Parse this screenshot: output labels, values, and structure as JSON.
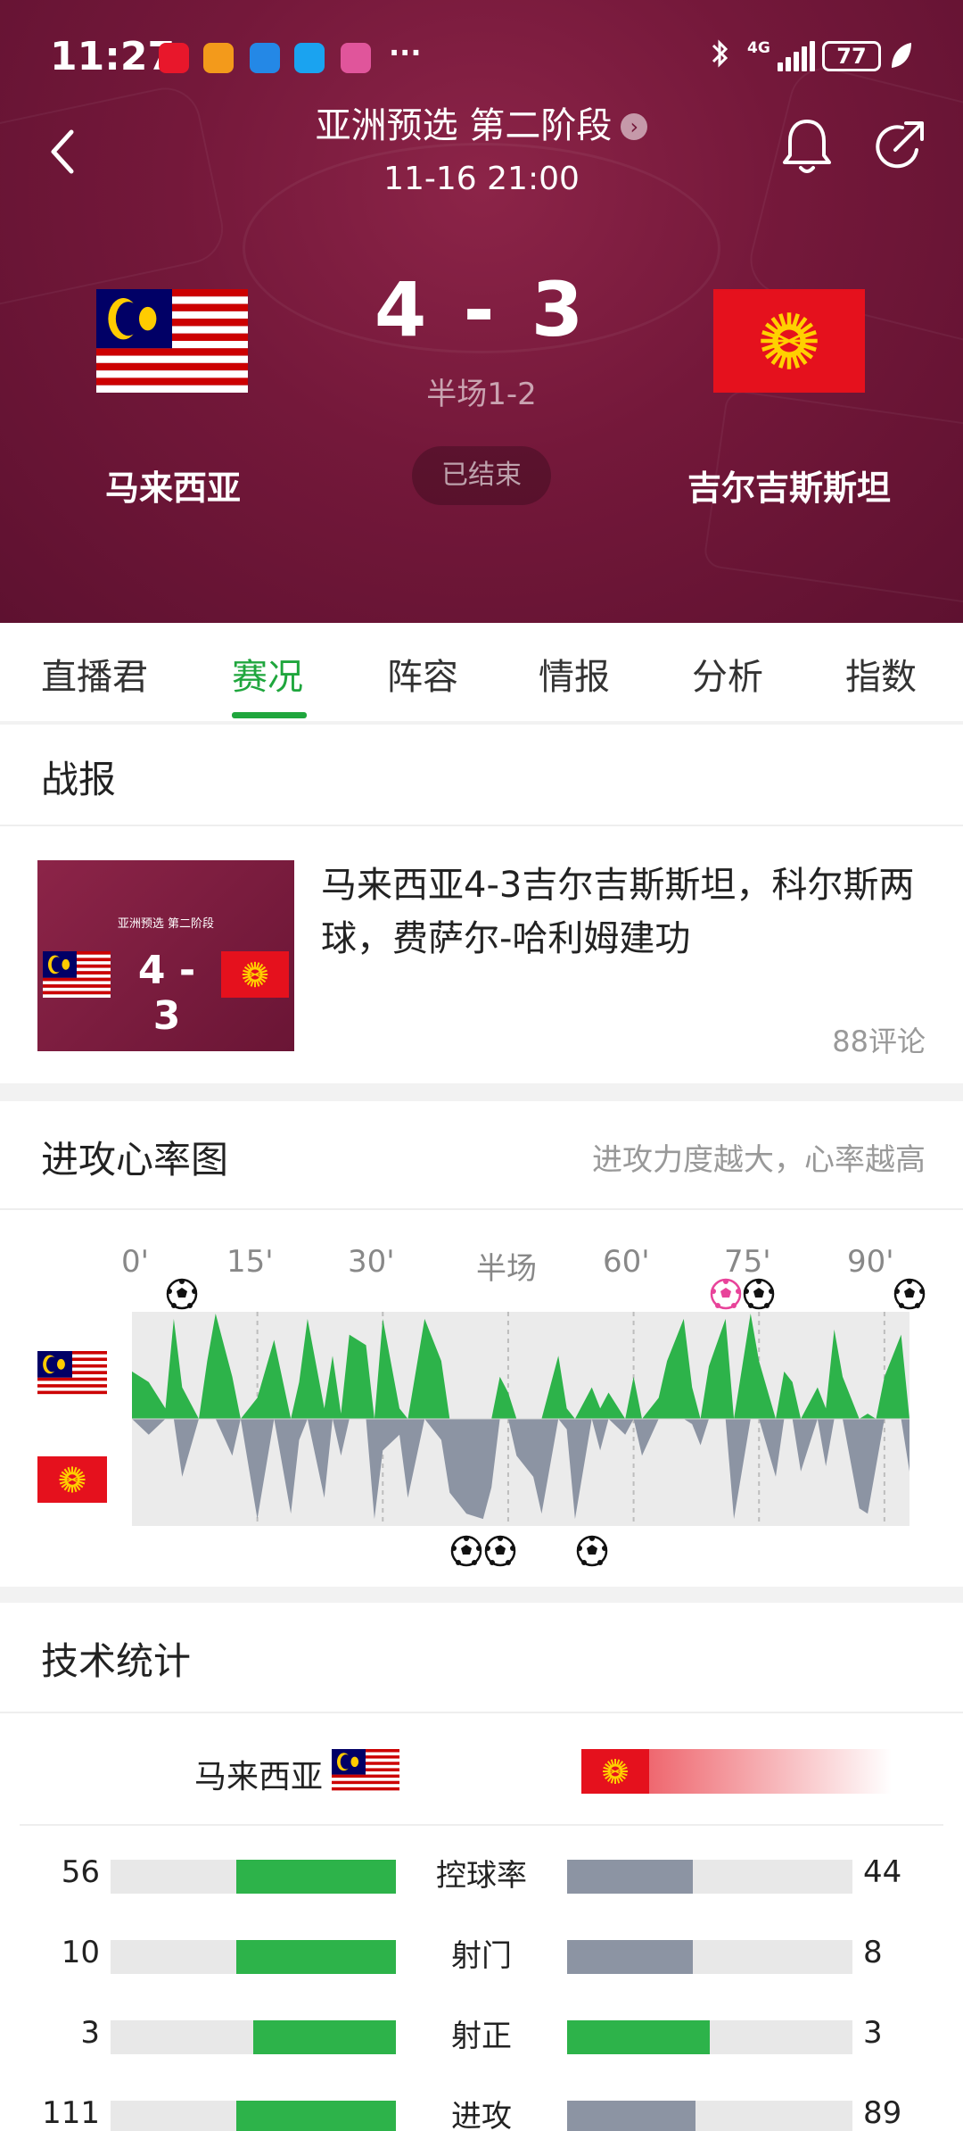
{
  "status_bar": {
    "time": "11:27",
    "network": "4G",
    "battery": "77",
    "notification_icons": [
      {
        "name": "app-icon-red",
        "color": "#e8172b"
      },
      {
        "name": "app-icon-orange",
        "color": "#f39a1b"
      },
      {
        "name": "app-icon-blue",
        "color": "#2488e6"
      },
      {
        "name": "app-icon-search",
        "color": "#1aa3f0"
      },
      {
        "name": "app-icon-pink",
        "color": "#e0559b"
      }
    ],
    "more": "···"
  },
  "header": {
    "title": "亚洲预选 第二阶段",
    "datetime": "11-16 21:00"
  },
  "match": {
    "home_team": "马来西亚",
    "away_team": "吉尔吉斯斯坦",
    "home_score": "4",
    "away_score": "3",
    "separator": "-",
    "halftime": "半场1-2",
    "status": "已结束"
  },
  "tabs": [
    {
      "label": "直播君",
      "active": false
    },
    {
      "label": "赛况",
      "active": true
    },
    {
      "label": "阵容",
      "active": false
    },
    {
      "label": "情报",
      "active": false
    },
    {
      "label": "分析",
      "active": false
    },
    {
      "label": "指数",
      "active": false
    }
  ],
  "report": {
    "section_title": "战报",
    "thumb_title": "亚洲预选 第二阶段",
    "thumb_score": "4 - 3",
    "headline": "马来西亚4-3吉尔吉斯斯坦，科尔斯两球，费萨尔-哈利姆建功",
    "comments": "88评论"
  },
  "heart_chart": {
    "section_title": "进攻心率图",
    "subtitle": "进攻力度越大，心率越高",
    "time_labels": [
      "0'",
      "15'",
      "30'",
      "半场",
      "60'",
      "75'",
      "90'"
    ],
    "colors": {
      "home": "#2db34a",
      "away": "#8c94a3"
    }
  },
  "chart_data": {
    "type": "area",
    "x": [
      0,
      2,
      4,
      5,
      6,
      8,
      9,
      10,
      12,
      13,
      15,
      17,
      19,
      20,
      21,
      23,
      24,
      25,
      26,
      28,
      29,
      30,
      32,
      33,
      35,
      37,
      38,
      40,
      42,
      43,
      44,
      45,
      46,
      48,
      49,
      51,
      52,
      53,
      55,
      56,
      57,
      59,
      60,
      61,
      63,
      64,
      66,
      67,
      68,
      69,
      71,
      72,
      74,
      75,
      77,
      78,
      79,
      80,
      82,
      83,
      84,
      85,
      87,
      88,
      89,
      90,
      92,
      93
    ],
    "series": [
      {
        "values": [
          0.45,
          0.35,
          0.1,
          0.95,
          0.3,
          0.0,
          0.55,
          1.0,
          0.4,
          0.0,
          0.2,
          0.75,
          0.0,
          0.35,
          0.95,
          0.1,
          0.6,
          0.05,
          0.8,
          0.7,
          0.0,
          0.95,
          0.1,
          0.0,
          0.95,
          0.55,
          0.0,
          0.0,
          0.0,
          0.0,
          0.4,
          0.25,
          0.0,
          0.0,
          0.0,
          0.6,
          0.1,
          0.0,
          0.3,
          0.1,
          0.25,
          0.0,
          0.4,
          0.0,
          0.2,
          0.55,
          0.95,
          0.3,
          0.0,
          0.5,
          0.95,
          0.0,
          1.0,
          0.55,
          0.0,
          0.45,
          0.35,
          0.0,
          0.3,
          0.1,
          0.85,
          0.4,
          0.0,
          0.05,
          0.0,
          0.4,
          0.8,
          0.0
        ]
      },
      {
        "values": [
          0.0,
          0.15,
          0.0,
          0.0,
          0.55,
          0.0,
          0.0,
          0.0,
          0.35,
          0.0,
          0.95,
          0.0,
          0.9,
          0.2,
          0.0,
          0.75,
          0.0,
          0.35,
          0.0,
          0.0,
          0.95,
          0.3,
          0.15,
          0.75,
          0.0,
          0.2,
          0.7,
          0.9,
          0.95,
          0.65,
          0.0,
          0.0,
          0.35,
          0.55,
          0.9,
          0.0,
          0.1,
          0.95,
          0.0,
          0.3,
          0.0,
          0.15,
          0.0,
          0.35,
          0.0,
          0.0,
          0.0,
          0.05,
          0.25,
          0.0,
          0.0,
          0.95,
          0.0,
          0.0,
          0.55,
          0.0,
          0.0,
          0.5,
          0.0,
          0.45,
          0.0,
          0.0,
          0.85,
          0.9,
          0.45,
          0.0,
          0.0,
          0.5
        ]
      }
    ],
    "home_goals_minutes": [
      6,
      71,
      75,
      93
    ],
    "home_goal_types": [
      "normal",
      "penalty",
      "normal",
      "normal"
    ],
    "away_goals_minutes": [
      40,
      44,
      55
    ],
    "xlim": [
      0,
      93
    ],
    "ylim": [
      -1,
      1
    ],
    "grid": "vertical dashed at 15' intervals",
    "legend": "flags on left"
  },
  "stats": {
    "section_title": "技术统计",
    "home_name": "马来西亚",
    "rows": [
      {
        "label": "控球率",
        "home": "56",
        "away": "44",
        "home_frac": 0.56,
        "away_frac": 0.44,
        "home_color": "#2db34a",
        "away_color": "#8c94a3"
      },
      {
        "label": "射门",
        "home": "10",
        "away": "8",
        "home_frac": 0.56,
        "away_frac": 0.44,
        "home_color": "#2db34a",
        "away_color": "#8c94a3"
      },
      {
        "label": "射正",
        "home": "3",
        "away": "3",
        "home_frac": 0.5,
        "away_frac": 0.5,
        "home_color": "#2db34a",
        "away_color": "#2db34a"
      },
      {
        "label": "进攻",
        "home": "111",
        "away": "89",
        "home_frac": 0.56,
        "away_frac": 0.45,
        "home_color": "#2db34a",
        "away_color": "#8c94a3"
      }
    ]
  }
}
